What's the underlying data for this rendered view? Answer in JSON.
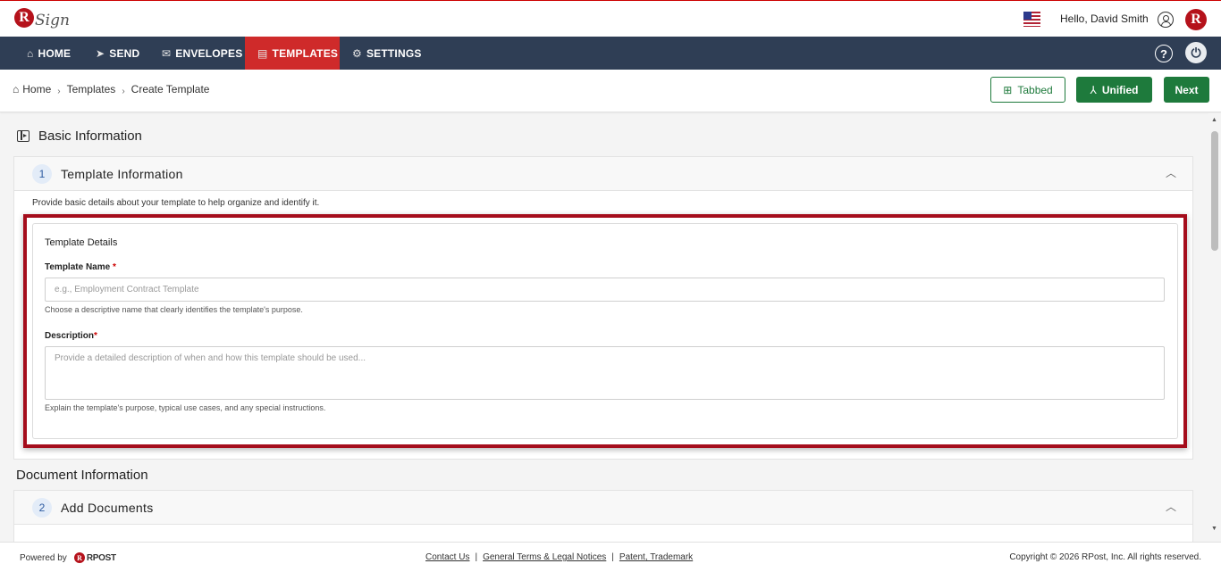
{
  "header": {
    "logo_text": "Sign",
    "logo_letter": "R",
    "greeting": "Hello, David Smith",
    "brand_letter": "R"
  },
  "nav": {
    "items": [
      {
        "label": "HOME",
        "icon": "home-icon",
        "glyph": "⌂"
      },
      {
        "label": "SEND",
        "icon": "send-icon",
        "glyph": "➤"
      },
      {
        "label": "ENVELOPES",
        "icon": "envelope-icon",
        "glyph": "✉"
      },
      {
        "label": "TEMPLATES",
        "icon": "template-icon",
        "glyph": "▤",
        "active": true
      },
      {
        "label": "SETTINGS",
        "icon": "gear-icon",
        "glyph": "⚙"
      }
    ],
    "help_glyph": "?",
    "power_glyph": "⏻"
  },
  "breadcrumb": [
    "Home",
    "Templates",
    "Create Template"
  ],
  "actions": {
    "tabbed": "Tabbed",
    "unified": "Unified",
    "next": "Next"
  },
  "sections": {
    "basic": "Basic Information",
    "document": "Document Information"
  },
  "template_info": {
    "step": "1",
    "title": "Template Information",
    "description": "Provide basic details about your template to help organize and identify it.",
    "card_title": "Template Details",
    "name_label": "Template Name",
    "name_placeholder": "e.g., Employment Contract Template",
    "name_hint": "Choose a descriptive name that clearly identifies the template's purpose.",
    "desc_label": "Description",
    "desc_placeholder": "Provide a detailed description of when and how this template should be used...",
    "desc_hint": "Explain the template's purpose, typical use cases, and any special instructions.",
    "required_mark": "*"
  },
  "add_documents": {
    "step": "2",
    "title": "Add Documents"
  },
  "footer": {
    "powered_by": "Powered by",
    "rpost_label": "RPOST",
    "links": [
      "Contact Us",
      "General Terms & Legal Notices",
      "Patent, Trademark"
    ],
    "copyright": "Copyright © 2026 RPost, Inc. All rights reserved."
  },
  "colors": {
    "nav_bg": "#2f3e55",
    "active_tab": "#cf2a2a",
    "brand_red": "#b5121b",
    "primary_green": "#1e7a3c",
    "highlight_border": "#a50d1c"
  }
}
